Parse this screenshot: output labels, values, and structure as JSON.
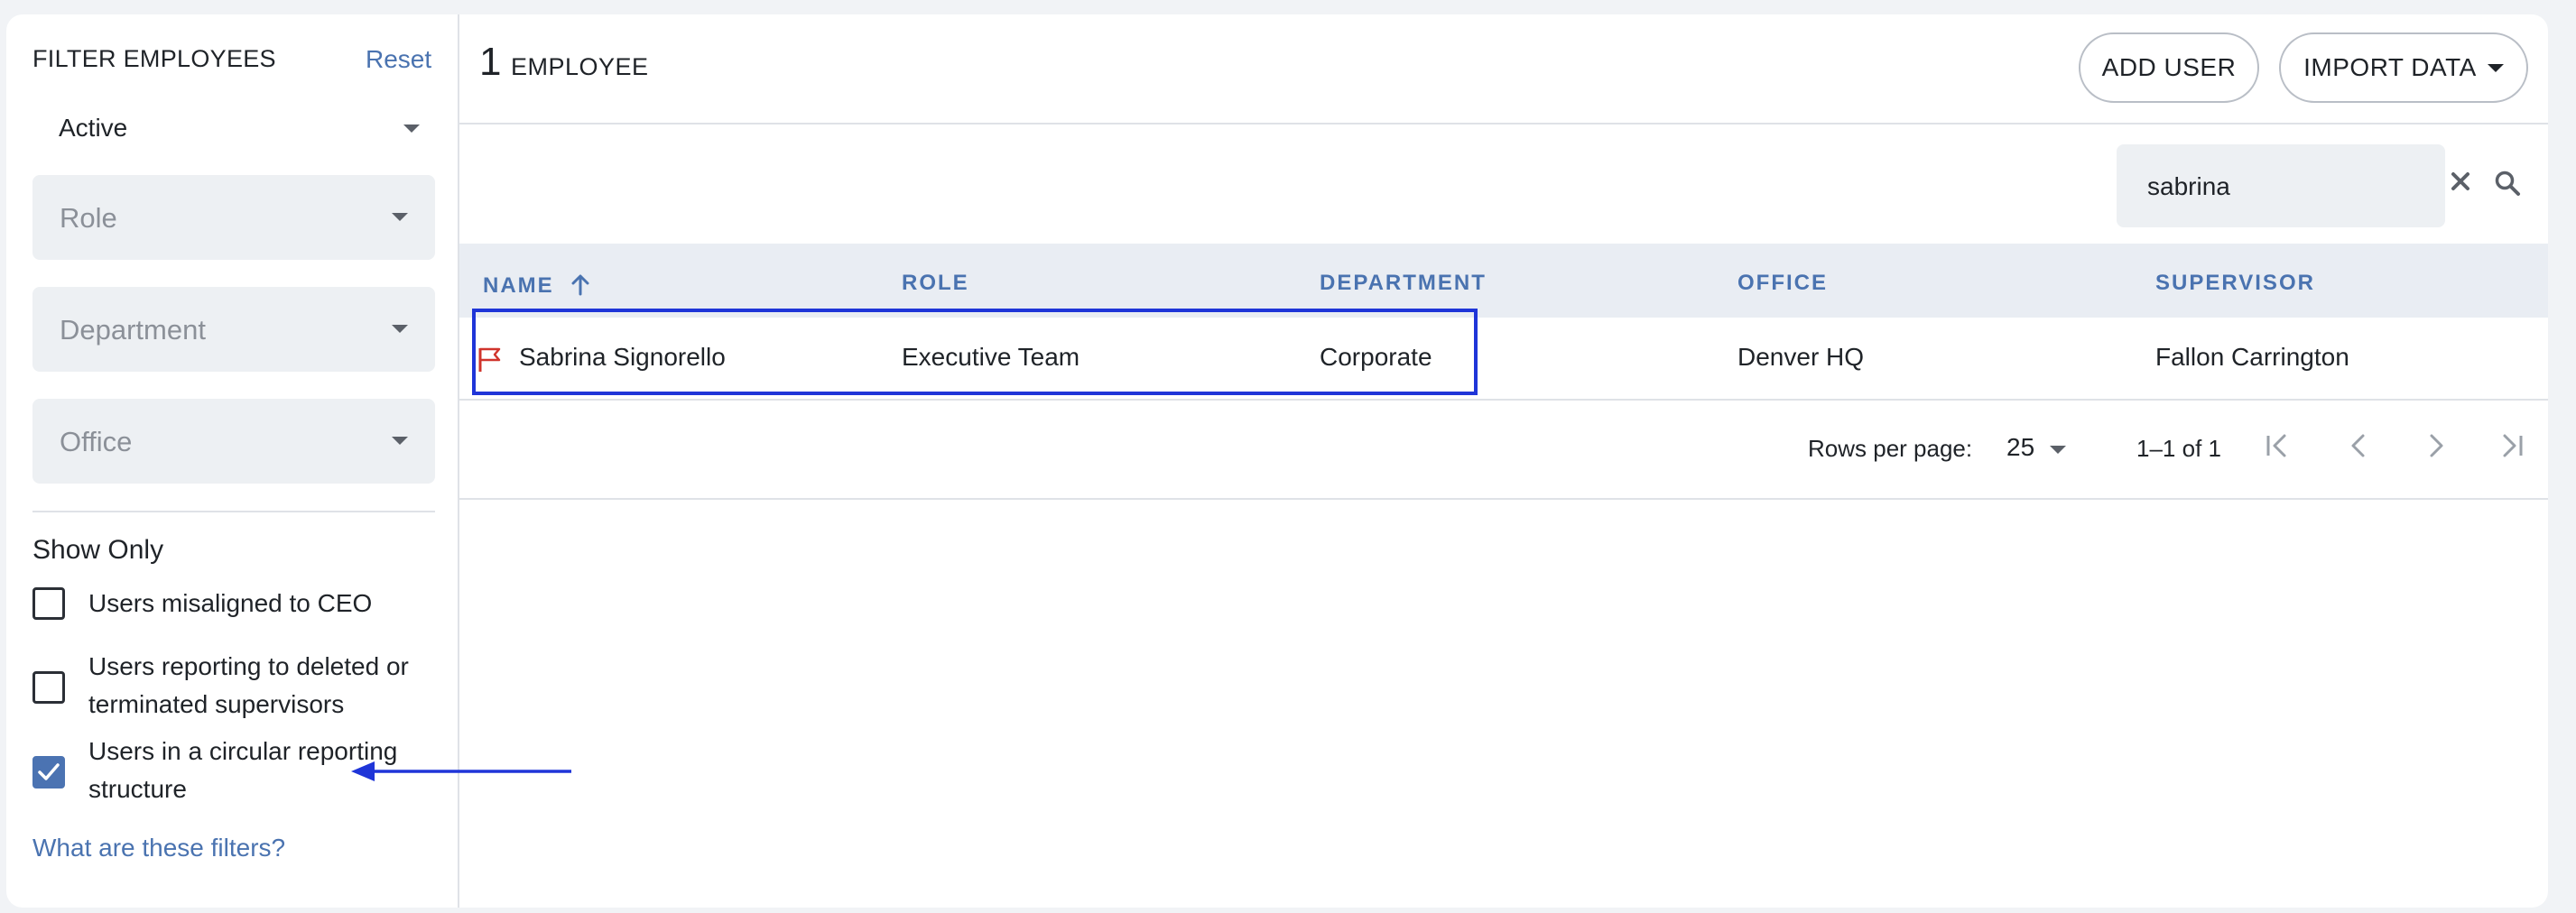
{
  "sidebar": {
    "title": "FILTER EMPLOYEES",
    "reset_label": "Reset",
    "status_value": "Active",
    "role_placeholder": "Role",
    "department_placeholder": "Department",
    "office_placeholder": "Office",
    "show_only_label": "Show Only",
    "checkboxes": [
      {
        "label": "Users misaligned to CEO",
        "checked": false
      },
      {
        "label": "Users reporting to deleted or terminated supervisors",
        "checked": false
      },
      {
        "label": "Users in a circular reporting structure",
        "checked": true
      }
    ],
    "help_link": "What are these filters?"
  },
  "header": {
    "count": "1",
    "count_label": "EMPLOYEE",
    "add_user_label": "ADD USER",
    "import_label": "IMPORT DATA"
  },
  "search": {
    "value": "sabrina"
  },
  "table": {
    "columns": [
      "NAME",
      "ROLE",
      "DEPARTMENT",
      "OFFICE",
      "SUPERVISOR"
    ],
    "rows": [
      {
        "name": "Sabrina Signorello",
        "role": "Executive Team",
        "department": "Corporate",
        "office": "Denver HQ",
        "supervisor": "Fallon Carrington"
      }
    ]
  },
  "pagination": {
    "rows_per_page_label": "Rows per page:",
    "rows_per_page": "25",
    "range": "1–1 of 1"
  },
  "colors": {
    "accent": "#4a73b0",
    "annotation": "#1f35d8",
    "flag": "#d0342c"
  }
}
